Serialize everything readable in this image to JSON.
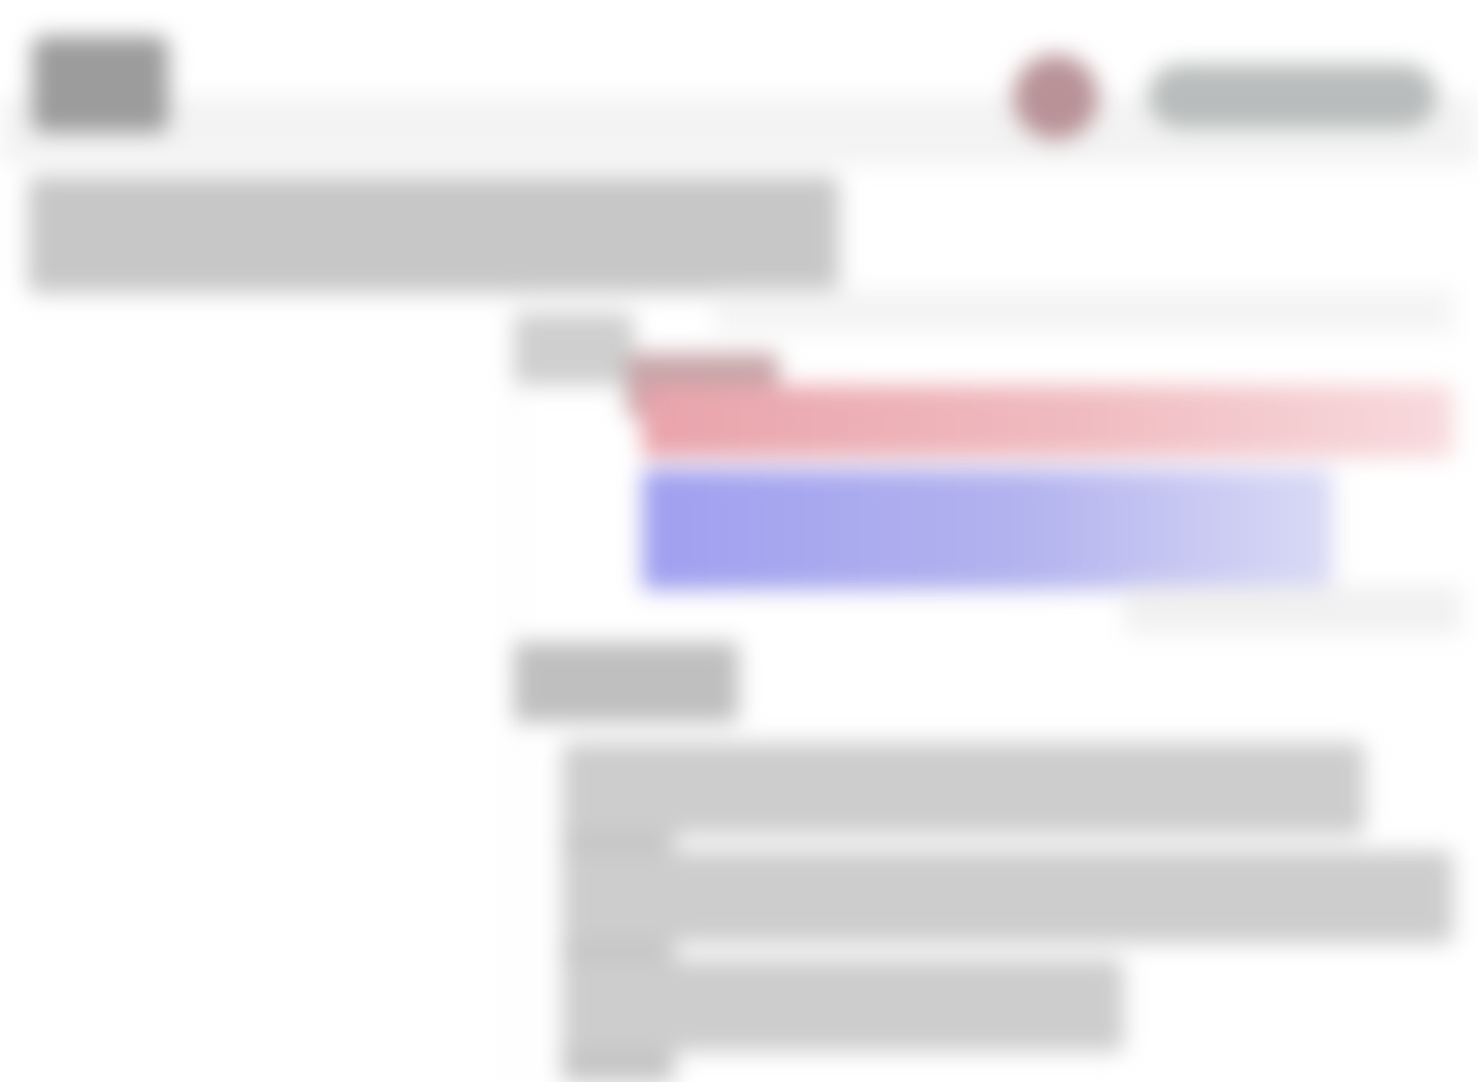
{
  "header": {
    "logo_icon": "app-logo-icon",
    "avatar_icon": "user-avatar-icon",
    "account_label": ""
  },
  "main": {
    "page_title": "",
    "section_label": "",
    "bars": [
      {
        "name": "red-bar",
        "color": "#e9a3ab"
      },
      {
        "name": "blue-bar",
        "color": "#9f9ff0"
      }
    ],
    "second_label": "",
    "rows": [
      "",
      "",
      ""
    ]
  }
}
